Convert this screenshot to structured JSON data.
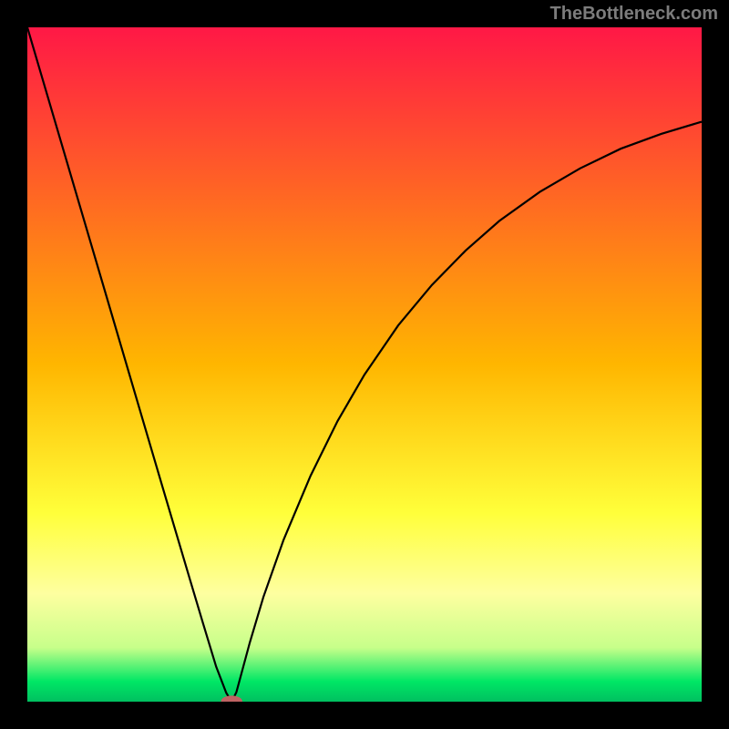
{
  "attribution": "TheBottleneck.com",
  "chart_data": {
    "type": "line",
    "title": "",
    "xlabel": "",
    "ylabel": "",
    "xlim": [
      0,
      100
    ],
    "ylim": [
      0,
      100
    ],
    "grid": false,
    "legend": false,
    "background_gradient": {
      "stops": [
        {
          "offset": 0,
          "color": "#ff1846"
        },
        {
          "offset": 50,
          "color": "#ffb600"
        },
        {
          "offset": 72,
          "color": "#ffff3a"
        },
        {
          "offset": 84,
          "color": "#feffa0"
        },
        {
          "offset": 92,
          "color": "#c7ff8a"
        },
        {
          "offset": 97,
          "color": "#00e765"
        },
        {
          "offset": 100,
          "color": "#00c060"
        }
      ]
    },
    "series": [
      {
        "name": "curve",
        "color": "#000000",
        "x": [
          0,
          5,
          10,
          15,
          20,
          24,
          26,
          28,
          29.5,
          30.3,
          31,
          33,
          35,
          38,
          42,
          46,
          50,
          55,
          60,
          65,
          70,
          76,
          82,
          88,
          94,
          100
        ],
        "y": [
          100,
          83,
          66,
          49,
          32,
          18.5,
          11.8,
          5.2,
          1.3,
          0.0,
          1.4,
          8.8,
          15.5,
          24.0,
          33.5,
          41.6,
          48.5,
          55.8,
          61.8,
          66.9,
          71.3,
          75.6,
          79.1,
          82.0,
          84.2,
          86.0
        ]
      }
    ],
    "marker": {
      "x": 30.3,
      "y": 0.0,
      "rx_percent": 1.6,
      "ry_percent": 0.9,
      "fill": "#bf6363"
    }
  }
}
